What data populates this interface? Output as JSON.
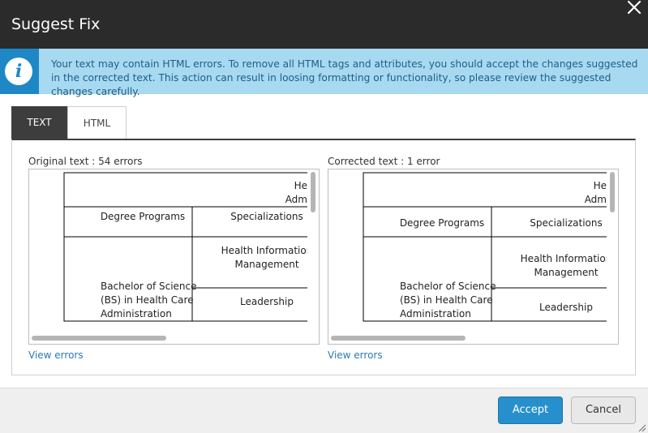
{
  "dialog": {
    "title": "Suggest Fix",
    "info_text": "Your text may contain HTML errors. To remove all HTML tags and attributes, you should accept the changes suggested in the corrected text. This action can result in loosing formatting or functionality, so please review the suggested changes carefully.",
    "close_icon": "close-icon",
    "info_icon": "info-icon"
  },
  "tabs": [
    {
      "label": "TEXT",
      "active": true
    },
    {
      "label": "HTML",
      "active": false
    }
  ],
  "original": {
    "label": "Original text : 54 errors",
    "view_errors": "View errors",
    "table": {
      "header_partial": [
        "He",
        "Adm"
      ],
      "col1": "Degree Programs",
      "col2": "Specializations",
      "row_label": [
        "Bachelor of Science",
        "(BS) in Health Care",
        "Administration"
      ],
      "spec1": [
        "Health Information",
        "Management"
      ],
      "spec2": "Leadership"
    }
  },
  "corrected": {
    "label": "Corrected text : 1 error",
    "view_errors": "View errors",
    "table": {
      "header_partial": [
        "He",
        "Adm"
      ],
      "col1": "Degree Programs",
      "col2": "Specializations",
      "row_label": [
        "Bachelor of Science",
        "(BS) in Health Care",
        "Administration"
      ],
      "spec1": [
        "Health Information",
        "Management"
      ],
      "spec2": "Leadership"
    }
  },
  "footer": {
    "accept_label": "Accept",
    "cancel_label": "Cancel"
  },
  "colors": {
    "header_bg": "#2b2b2b",
    "info_bg": "#a7d9f0",
    "info_icon_bg": "#1e88c7",
    "accent": "#2790cc",
    "link": "#2a7ab9"
  }
}
